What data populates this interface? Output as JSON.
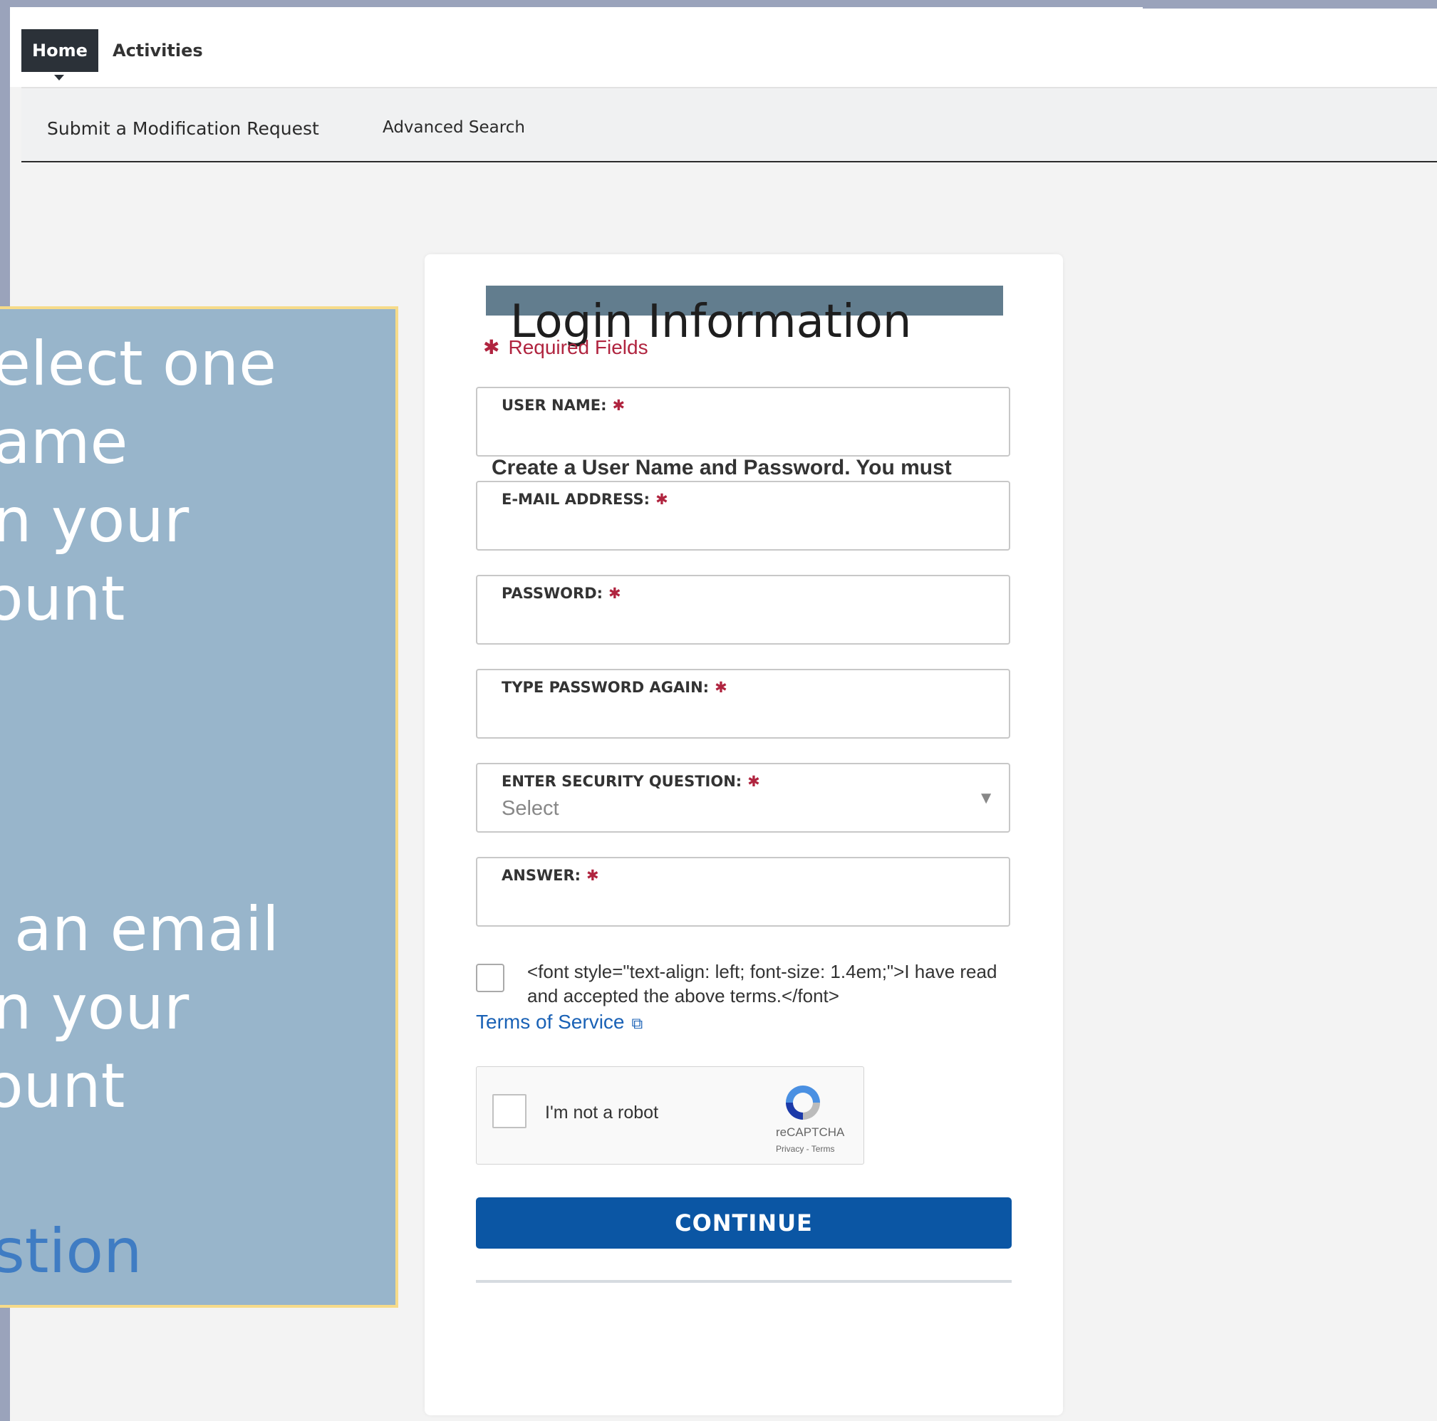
{
  "nav": {
    "tabs": [
      "Home",
      "Activities"
    ],
    "subnav": [
      "Submit a Modification Request",
      "Advanced Search"
    ]
  },
  "form": {
    "title": "Login Information",
    "required_note": "Required Fields",
    "helper_text": "Create a User Name and Password.  You must",
    "fields": [
      {
        "label": "USER NAME:",
        "value": ""
      },
      {
        "label": "E-MAIL ADDRESS:",
        "value": ""
      },
      {
        "label": "PASSWORD:",
        "value": ""
      },
      {
        "label": "TYPE PASSWORD AGAIN:",
        "value": ""
      },
      {
        "label": "ENTER SECURITY QUESTION:",
        "value": "Select"
      },
      {
        "label": "ANSWER:",
        "value": ""
      }
    ],
    "terms_text": "<font style=\"text-align: left; font-size: 1.4em;\">I have read and accepted the above terms.</font>",
    "terms_link": "Terms of Service",
    "recaptcha": {
      "label": "I'm not a robot",
      "brand": "reCAPTCHA",
      "links": "Privacy - Terms"
    },
    "continue_label": "CONTINUE"
  },
  "overlay": {
    "lines": [
      "elect one",
      "ame",
      "n your",
      "ount",
      "an email",
      "n your",
      "ount",
      "stion"
    ]
  },
  "colors": {
    "primary_button": "#0b56a4",
    "required": "#b0243f",
    "link": "#1a62b6",
    "overlay_bg": "#98b5cb",
    "overlay_border": "#f6db8a"
  }
}
